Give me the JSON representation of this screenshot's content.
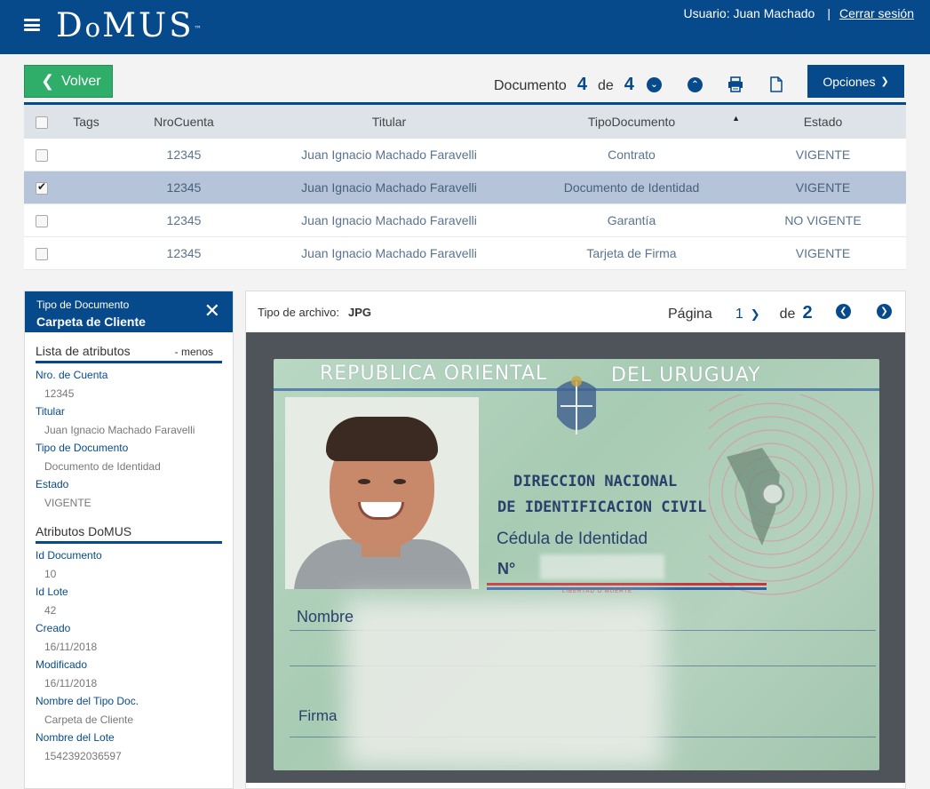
{
  "header": {
    "brand": "DoMUS",
    "user_label": "Usuario: Juan Machado",
    "logout": "Cerrar sesión"
  },
  "toolbar": {
    "back_label": "Volver",
    "doc_label": "Documento",
    "doc_current": "4",
    "doc_of": "de",
    "doc_total": "4",
    "options_label": "Opciones"
  },
  "table": {
    "headers": [
      "Tags",
      "NroCuenta",
      "Titular",
      "TipoDocumento",
      "Estado"
    ],
    "rows": [
      {
        "checked": false,
        "cuenta": "12345",
        "titular": "Juan Ignacio Machado Faravelli",
        "tipo": "Contrato",
        "estado": "VIGENTE"
      },
      {
        "checked": true,
        "cuenta": "12345",
        "titular": "Juan Ignacio Machado Faravelli",
        "tipo": "Documento de Identidad",
        "estado": "VIGENTE"
      },
      {
        "checked": false,
        "cuenta": "12345",
        "titular": "Juan Ignacio Machado Faravelli",
        "tipo": "Garantía",
        "estado": "NO VIGENTE"
      },
      {
        "checked": false,
        "cuenta": "12345",
        "titular": "Juan Ignacio Machado Faravelli",
        "tipo": "Tarjeta de Firma",
        "estado": "VIGENTE"
      }
    ]
  },
  "side": {
    "head_small": "Tipo de Documento",
    "head_big": "Carpeta de Cliente",
    "sec1_title": "Lista de atributos",
    "sec1_toggle": "- menos",
    "sec1_attrs": [
      {
        "k": "Nro. de Cuenta",
        "v": "12345"
      },
      {
        "k": "Titular",
        "v": "Juan Ignacio Machado Faravelli"
      },
      {
        "k": "Tipo de Documento",
        "v": "Documento de Identidad"
      },
      {
        "k": "Estado",
        "v": "VIGENTE"
      }
    ],
    "sec2_title": "Atributos DoMUS",
    "sec2_attrs": [
      {
        "k": "Id Documento",
        "v": "10"
      },
      {
        "k": "Id Lote",
        "v": "42"
      },
      {
        "k": "Creado",
        "v": "16/11/2018"
      },
      {
        "k": "Modificado",
        "v": "16/11/2018"
      },
      {
        "k": "Nombre del Tipo Doc.",
        "v": "Carpeta de Cliente"
      },
      {
        "k": "Nombre del Lote",
        "v": "1542392036597"
      }
    ]
  },
  "viewer": {
    "file_type_label": "Tipo de archivo:",
    "file_type": "JPG",
    "page_label": "Página",
    "page_current": "1",
    "page_of": "de",
    "page_total": "2"
  },
  "card": {
    "header_left": "REPUBLICA ORIENTAL",
    "header_right": "DEL URUGUAY",
    "line1": "DIRECCION NACIONAL",
    "line2": "DE IDENTIFICACION CIVIL",
    "line3": "Cédula de Identidad",
    "number_label": "N°",
    "motto": "LIBERTAD O MUERTE",
    "name_label": "Nombre",
    "signature_label": "Firma"
  }
}
